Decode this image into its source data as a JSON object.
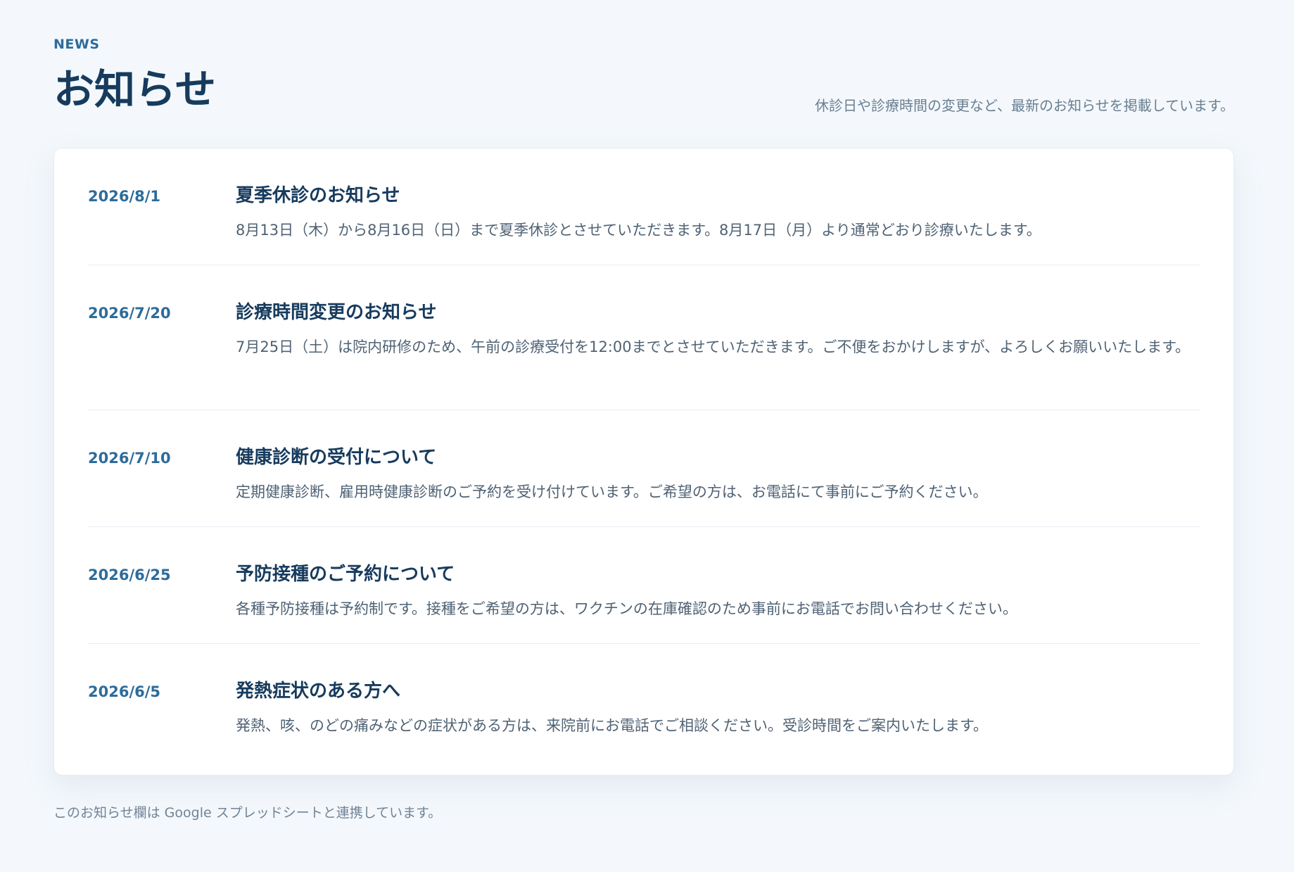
{
  "header": {
    "eyebrow": "NEWS",
    "title": "お知らせ",
    "description": "休診日や診療時間の変更など、最新のお知らせを掲載しています。"
  },
  "news": {
    "items": [
      {
        "date": "2026/8/1",
        "title": "夏季休診のお知らせ",
        "body": "8月13日（木）から8月16日（日）まで夏季休診とさせていただきます。8月17日（月）より通常どおり診療いたします。"
      },
      {
        "date": "2026/7/20",
        "title": "診療時間変更のお知らせ",
        "body": "7月25日（土）は院内研修のため、午前の診療受付を12:00までとさせていただきます。ご不便をおかけしますが、よろしくお願いいたします。"
      },
      {
        "date": "2026/7/10",
        "title": "健康診断の受付について",
        "body": "定期健康診断、雇用時健康診断のご予約を受け付けています。ご希望の方は、お電話にて事前にご予約ください。"
      },
      {
        "date": "2026/6/25",
        "title": "予防接種のご予約について",
        "body": "各種予防接種は予約制です。接種をご希望の方は、ワクチンの在庫確認のため事前にお電話でお問い合わせください。"
      },
      {
        "date": "2026/6/5",
        "title": "発熱症状のある方へ",
        "body": "発熱、咳、のどの痛みなどの症状がある方は、来院前にお電話でご相談ください。受診時間をご案内いたします。"
      }
    ]
  },
  "footer": {
    "note": "このお知らせ欄は Google スプレッドシートと連携しています。"
  },
  "colors": {
    "background": "#f4f8fc",
    "card": "#ffffff",
    "accent": "#2d6c9a",
    "title": "#173b5d",
    "body_text": "#4f6274",
    "muted_text": "#697e90",
    "divider": "#e7edf3"
  }
}
